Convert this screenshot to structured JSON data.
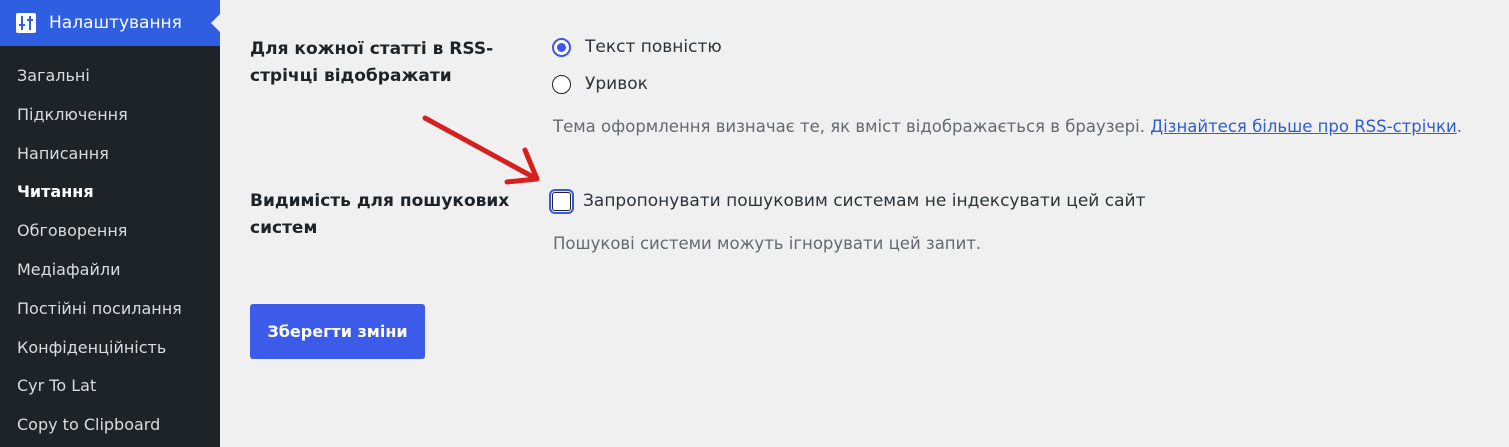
{
  "sidebar": {
    "header": "Налаштування",
    "items": [
      {
        "label": "Загальні"
      },
      {
        "label": "Підключення"
      },
      {
        "label": "Написання"
      },
      {
        "label": "Читання"
      },
      {
        "label": "Обговорення"
      },
      {
        "label": "Медіафайли"
      },
      {
        "label": "Постійні посилання"
      },
      {
        "label": "Конфіденційність"
      },
      {
        "label": "Cyr To Lat"
      },
      {
        "label": "Copy to Clipboard"
      }
    ]
  },
  "rss": {
    "label_line1": "Для кожної статті в RSS-",
    "label_line2": "стрічці відображати",
    "option_full": "Текст повністю",
    "option_excerpt": "Уривок",
    "description": "Тема оформлення визначає те, як вміст відображається в браузері. ",
    "link": "Дізнайтеся більше про RSS-стрічки",
    "after_link": "."
  },
  "visibility": {
    "label_line1": "Видимість для пошукових",
    "label_line2": "систем",
    "checkbox_label": "Запропонувати пошуковим системам не індексувати цей сайт",
    "description": "Пошукові системи можуть ігнорувати цей запит."
  },
  "save_label": "Зберегти зміни",
  "colors": {
    "accent": "#3858e9",
    "sidebar_bg": "#1d2327",
    "arrow": "#d61f1f"
  }
}
